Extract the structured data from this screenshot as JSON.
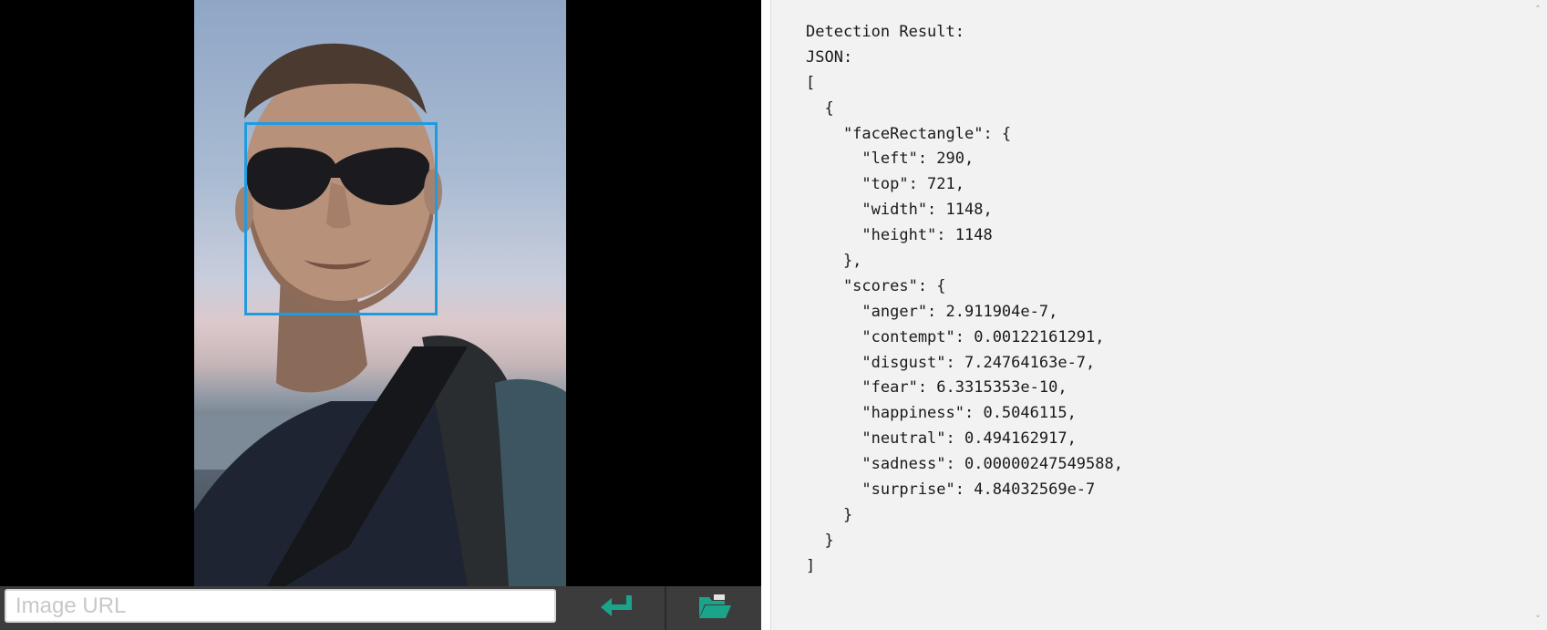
{
  "image_pane": {
    "face_box_color": "#1f9be0",
    "photo_description_icon": "portrait-photo"
  },
  "toolbar": {
    "url_placeholder": "Image URL",
    "url_value": "",
    "enter_icon": "enter-return-icon",
    "open_icon": "folder-open-icon",
    "icon_color": "#1aa58a"
  },
  "result": {
    "lines": [
      "Detection Result:",
      "JSON:",
      "[",
      "  {",
      "    \"faceRectangle\": {",
      "      \"left\": 290,",
      "      \"top\": 721,",
      "      \"width\": 1148,",
      "      \"height\": 1148",
      "    },",
      "    \"scores\": {",
      "      \"anger\": 2.911904e-7,",
      "      \"contempt\": 0.00122161291,",
      "      \"disgust\": 7.24764163e-7,",
      "      \"fear\": 6.3315353e-10,",
      "      \"happiness\": 0.5046115,",
      "      \"neutral\": 0.494162917,",
      "      \"sadness\": 0.00000247549588,",
      "      \"surprise\": 4.84032569e-7",
      "    }",
      "  }",
      "]"
    ]
  },
  "scrollbar": {
    "up_glyph": "˄",
    "down_glyph": "˅"
  }
}
